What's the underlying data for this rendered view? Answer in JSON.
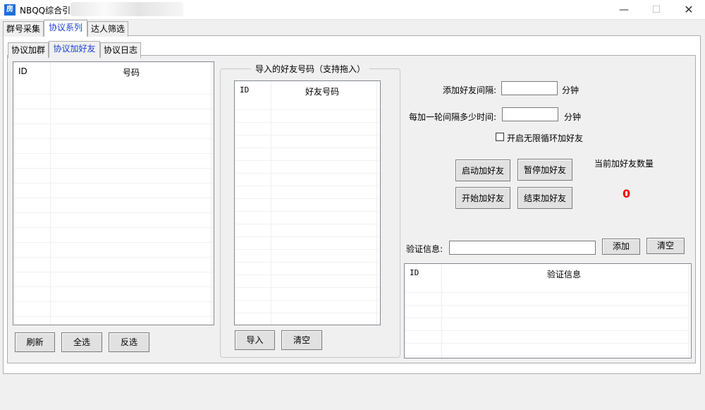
{
  "window": {
    "title": "NBQQ综合引",
    "icon_text": "房",
    "icon": "app-icon",
    "min_glyph": "—",
    "max_glyph": "☐",
    "close_glyph": "✕"
  },
  "outer_tabs": [
    "群号采集",
    "协议系列",
    "达人筛选"
  ],
  "inner_tabs": [
    "协议加群",
    "协议加好友",
    "协议日志"
  ],
  "group_list": {
    "col_id": "ID",
    "col_number": "号码"
  },
  "import_group": {
    "title": "导入的好友号码（支持拖入）",
    "col_id": "ID",
    "col_number": "好友号码",
    "import_label": "导入",
    "clear_label": "清空"
  },
  "left_buttons": {
    "refresh": "刷新",
    "select_all": "全选",
    "invert": "反选"
  },
  "settings": {
    "interval_label": "添加好友间隔:",
    "interval_value": "",
    "interval_unit": "分钟",
    "round_label": "每加一轮间隔多少时间:",
    "round_value": "",
    "round_unit": "分钟",
    "loop_label": "开启无限循环加好友",
    "loop_checked": false
  },
  "actions": {
    "start": "启动加好友",
    "pause": "暂停加好友",
    "begin": "开始加好友",
    "end": "结束加好友"
  },
  "counter": {
    "label": "当前加好友数量",
    "value": "0"
  },
  "verify": {
    "label": "验证信息:",
    "value": "",
    "add_label": "添加",
    "clear_label": "清空",
    "col_id": "ID",
    "col_info": "验证信息"
  },
  "colors": {
    "accent_tab": "#1a3fd4",
    "count": "#e00000"
  }
}
